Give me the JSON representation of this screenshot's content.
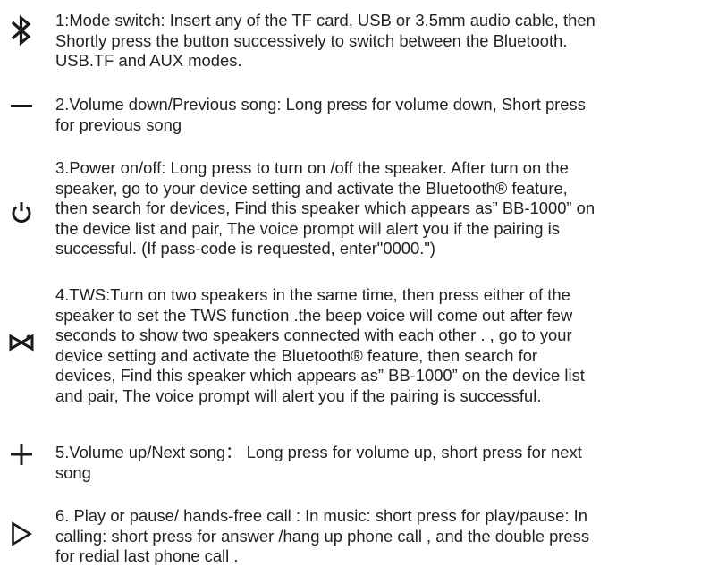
{
  "items": [
    {
      "icon": "bluetooth-icon",
      "text": "1:Mode switch: Insert any of the TF card, USB or 3.5mm audio cable, then\nShortly press the  button successively to switch between the Bluetooth.\nUSB.TF and AUX modes."
    },
    {
      "icon": "minus-icon",
      "text": "2.Volume down/Previous song: Long press for volume down,  Short press\nfor previous song"
    },
    {
      "icon": "power-icon",
      "text": "3.Power on/off:  Long press to turn on /off the speaker.  After turn on the\nspeaker, go to your device setting and activate the Bluetooth® feature,\nthen search for devices, Find this speaker which appears as” BB-1000” on\nthe device list and pair, The voice prompt will alert you if the pairing is\nsuccessful. (If pass-code is requested, enter\"0000.\")"
    },
    {
      "icon": "tws-icon",
      "text": "4.TWS:Turn on two speakers in the same time, then press either of the\nspeaker to set the TWS function .the beep voice will come out after few\nseconds to show two speakers connected with each other . , go to your\ndevice setting and activate the Bluetooth® feature, then search for\ndevices, Find this speaker which appears as” BB-1000” on the device list\nand pair, The voice prompt will alert you if the pairing is successful."
    },
    {
      "icon": "plus-icon",
      "text": "5.Volume up/Next song： Long press for volume up, short press for next\nsong"
    },
    {
      "icon": "play-icon",
      "text": "6. Play or pause/ hands-free call : In music: short press for play/pause:  In\ncalling: short press for answer /hang up phone call , and the double press\nfor redial last phone call ."
    }
  ]
}
